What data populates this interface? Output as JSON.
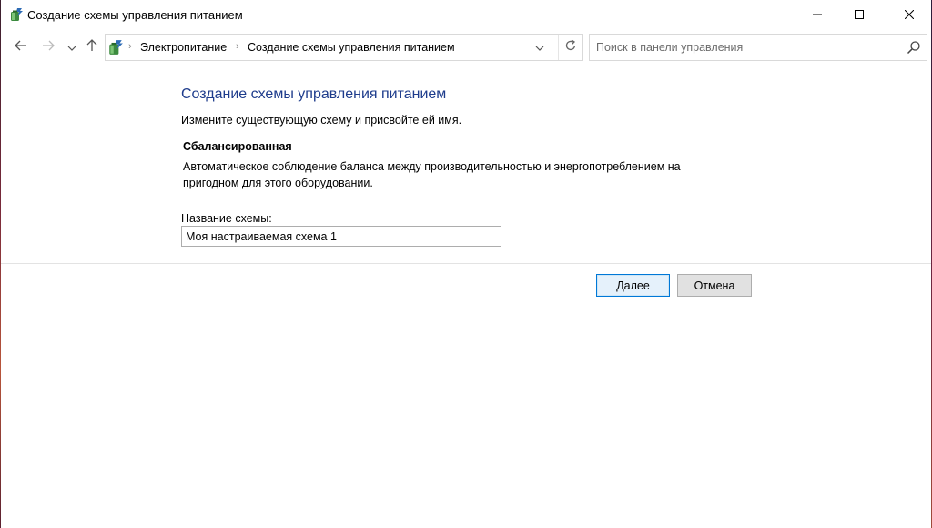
{
  "window": {
    "title": "Создание схемы управления питанием"
  },
  "nav": {
    "breadcrumbs": [
      "Электропитание",
      "Создание схемы управления питанием"
    ],
    "search_placeholder": "Поиск в панели управления"
  },
  "main": {
    "heading": "Создание схемы управления питанием",
    "intro": "Измените существующую схему и присвойте ей имя.",
    "scheme": {
      "name": "Сбалансированная",
      "description": "Автоматическое соблюдение баланса между производительностью и энергопотреблением на пригодном для этого оборудовании."
    },
    "field_label": "Название схемы:",
    "field_value": "Моя настраиваемая схема 1"
  },
  "buttons": {
    "next": "Далее",
    "cancel": "Отмена"
  },
  "colors": {
    "heading": "#1e3c8c",
    "primary_button_border": "#0078d7"
  },
  "icons": [
    "power-options-icon",
    "back-arrow-icon",
    "forward-arrow-icon",
    "chevron-down-icon",
    "up-arrow-icon",
    "chevron-right-icon",
    "refresh-icon",
    "search-icon",
    "minimize-icon",
    "maximize-icon",
    "close-icon"
  ]
}
